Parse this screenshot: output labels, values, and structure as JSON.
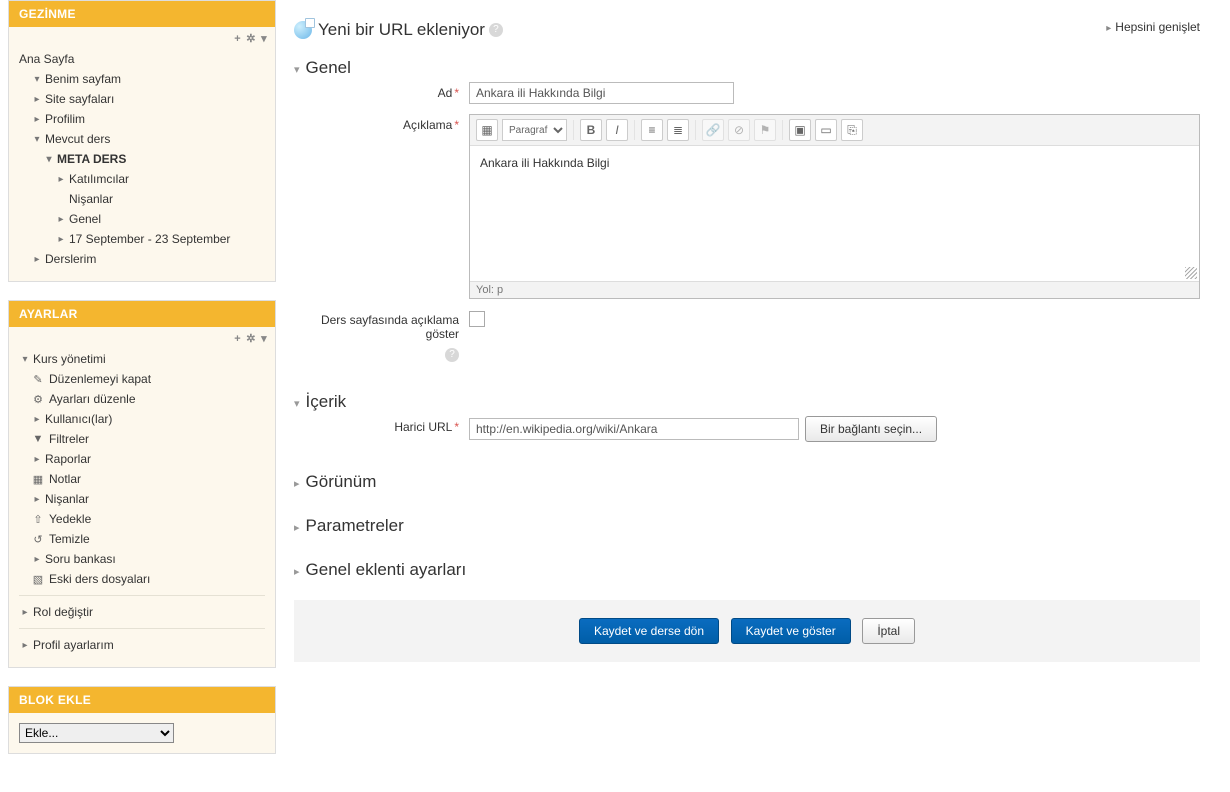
{
  "nav": {
    "block_title": "GEZİNME",
    "home": "Ana Sayfa",
    "items": [
      {
        "label": "Benim sayfam",
        "toggle": "▾"
      },
      {
        "label": "Site sayfaları",
        "toggle": "▸"
      },
      {
        "label": "Profilim",
        "toggle": "▸"
      },
      {
        "label": "Mevcut ders",
        "toggle": "▾"
      }
    ],
    "course": {
      "label": "META DERS",
      "toggle": "▾"
    },
    "course_children": [
      {
        "label": "Katılımcılar",
        "toggle": "▸"
      },
      {
        "label": "Nişanlar",
        "icon": ""
      },
      {
        "label": "Genel",
        "toggle": "▸"
      },
      {
        "label": "17 September - 23 September",
        "toggle": "▸"
      }
    ],
    "my_courses": {
      "label": "Derslerim",
      "toggle": "▸"
    }
  },
  "settings": {
    "block_title": "AYARLAR",
    "root": {
      "label": "Kurs yönetimi",
      "toggle": "▾"
    },
    "items": [
      {
        "label": "Düzenlemeyi kapat",
        "icon": "✎"
      },
      {
        "label": "Ayarları düzenle",
        "icon": "⚙"
      },
      {
        "label": "Kullanıcı(lar)",
        "toggle": "▸"
      },
      {
        "label": "Filtreler",
        "icon": "▼"
      },
      {
        "label": "Raporlar",
        "toggle": "▸"
      },
      {
        "label": "Notlar",
        "icon": "▦"
      },
      {
        "label": "Nişanlar",
        "toggle": "▸"
      },
      {
        "label": "Yedekle",
        "icon": "⇧"
      },
      {
        "label": "Temizle",
        "icon": "↺"
      },
      {
        "label": "Soru bankası",
        "toggle": "▸"
      },
      {
        "label": "Eski ders dosyaları",
        "icon": "▧"
      }
    ],
    "role": {
      "label": "Rol değiştir",
      "toggle": "▸"
    },
    "profile": {
      "label": "Profil ayarlarım",
      "toggle": "▸"
    }
  },
  "addblock": {
    "title": "BLOK EKLE",
    "placeholder": "Ekle..."
  },
  "header": {
    "title": "Yeni bir URL ekleniyor",
    "expand_all": "Hepsini genişlet"
  },
  "sections": {
    "general": "Genel",
    "content": "İçerik",
    "appearance": "Görünüm",
    "parameters": "Parametreler",
    "common": "Genel eklenti ayarları"
  },
  "form": {
    "name_label": "Ad",
    "name_value": "Ankara ili Hakkında Bilgi",
    "desc_label": "Açıklama",
    "desc_value": "Ankara ili Hakkında Bilgi",
    "editor_format": "Paragraf",
    "editor_path": "Yol: p",
    "show_desc_label": "Ders sayfasında açıklama göster",
    "url_label": "Harici URL",
    "url_value": "http://en.wikipedia.org/wiki/Ankara",
    "choose_link": "Bir bağlantı seçin..."
  },
  "buttons": {
    "save_return": "Kaydet ve derse dön",
    "save_display": "Kaydet ve göster",
    "cancel": "İptal"
  }
}
